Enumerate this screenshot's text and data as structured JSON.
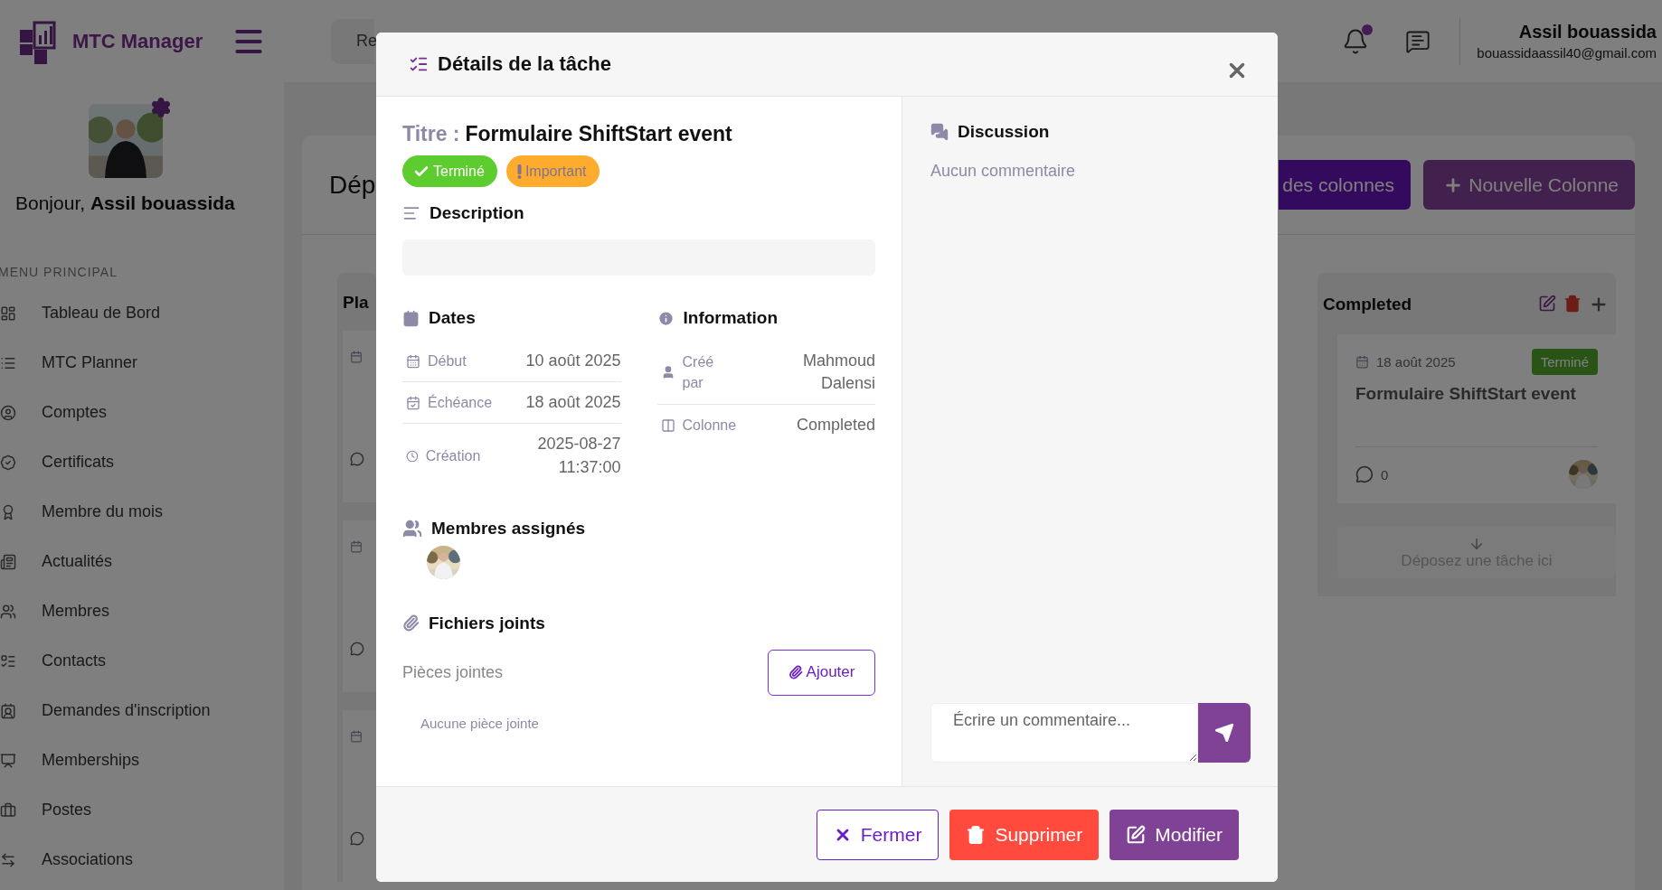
{
  "topbar": {
    "brand": "MTC Manager",
    "search": {
      "value": "Re"
    },
    "notifications": {
      "unread": true
    },
    "user": {
      "name": "Assil bouassida",
      "email": "bouassidaassil40@gmail.com"
    }
  },
  "sidebar": {
    "greeting": "Bonjour, **Assil bouassida**",
    "section": "MENU PRINCIPAL",
    "items": [
      {
        "label": "Tableau de Bord"
      },
      {
        "label": "MTC Planner"
      },
      {
        "label": "Comptes"
      },
      {
        "label": "Certificats"
      },
      {
        "label": "Membre du mois"
      },
      {
        "label": "Actualités"
      },
      {
        "label": "Membres"
      },
      {
        "label": "Contacts"
      },
      {
        "label": "Demandes d'inscription"
      },
      {
        "label": "Memberships"
      },
      {
        "label": "Postes"
      },
      {
        "label": "Associations"
      }
    ]
  },
  "main": {
    "heading": "Dép",
    "buttons": [
      {
        "label": "des colonnes",
        "kind": "columns"
      },
      {
        "label": "Nouvelle Colonne",
        "kind": "add"
      }
    ]
  },
  "columns": [
    {
      "title": "Pla",
      "cards": [
        {
          "kind": "fragment"
        },
        {
          "kind": "fragment"
        },
        {
          "kind": "fragment"
        }
      ]
    },
    {
      "title": "Completed",
      "cards": [
        {
          "kind": "task",
          "date": "18 août 2025",
          "status": "Terminé",
          "title": "Formulaire ShiftStart event",
          "comments": "0"
        }
      ],
      "drop_hint": "Déposez une tâche ici"
    }
  ],
  "modal": {
    "title": "Détails de la tâche",
    "task_label": "Titre :",
    "task_title": "Formulaire ShiftStart event",
    "badges": [
      {
        "label": "Terminé",
        "kind": "status"
      },
      {
        "label": "Important",
        "kind": "priority"
      }
    ],
    "description": {
      "heading": "Description"
    },
    "dates": {
      "heading": "Dates",
      "rows": [
        {
          "kind": "start",
          "label": "Début",
          "value": "10 août 2025"
        },
        {
          "kind": "due",
          "label": "Échéance",
          "value": "18 août 2025"
        },
        {
          "kind": "created",
          "label": "Création",
          "value": "2025-08-27 11:37:00"
        }
      ]
    },
    "information": {
      "heading": "Information",
      "rows": [
        {
          "kind": "creator",
          "label": "Créé par",
          "value": "Mahmoud Dalensi"
        },
        {
          "kind": "column",
          "label": "Colonne",
          "value": "Completed"
        }
      ]
    },
    "members": {
      "heading": "Membres assignés"
    },
    "files": {
      "heading": "Fichiers joints",
      "label": "Pièces jointes",
      "add_button": "Ajouter",
      "empty": "Aucune pièce jointe"
    },
    "discussion": {
      "heading": "Discussion",
      "empty": "Aucun commentaire",
      "comment_field": {
        "placeholder": "Écrire un commentaire..."
      }
    },
    "footer_buttons": [
      {
        "label": "Fermer",
        "kind": "close"
      },
      {
        "label": "Supprimer",
        "kind": "delete"
      },
      {
        "label": "Modifier",
        "kind": "edit"
      }
    ]
  }
}
